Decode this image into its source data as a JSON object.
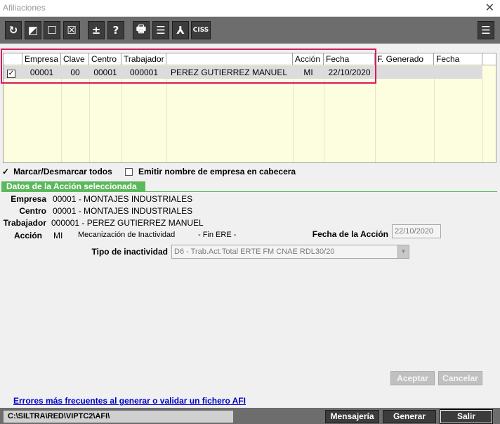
{
  "window": {
    "title": "Afiliaciones",
    "close_glyph": "✕"
  },
  "toolbar": {
    "buttons": [
      {
        "name": "refresh-icon",
        "glyph": "↻"
      },
      {
        "name": "half-select-icon",
        "glyph": "◩"
      },
      {
        "name": "square-icon",
        "glyph": "☐"
      },
      {
        "name": "clear-selection-icon",
        "glyph": "☒"
      },
      {
        "name": "plus-minus-icon",
        "glyph": "±"
      },
      {
        "name": "help-icon",
        "glyph": "?"
      },
      {
        "name": "printer-icon",
        "glyph": "🖶"
      },
      {
        "name": "list-icon",
        "glyph": "☰"
      },
      {
        "name": "pdf-icon",
        "glyph": "⅄"
      },
      {
        "name": "ciss-icon",
        "glyph": "CISS"
      }
    ],
    "menu_glyph": "☰"
  },
  "grid": {
    "headers": [
      "Empresa",
      "Clave",
      "Centro",
      "Trabajador",
      "",
      "Acción",
      "Fecha",
      "F. Generado",
      "Fecha"
    ],
    "rows": [
      {
        "checked": "✓",
        "empresa": "00001",
        "clave": "00",
        "centro": "00001",
        "trabajador": "000001",
        "nombre": "PEREZ GUTIERREZ MANUEL",
        "accion": "MI",
        "fecha": "22/10/2020"
      }
    ]
  },
  "options": {
    "toggle_all_mark": "✓",
    "toggle_all_label": "Marcar/Desmarcar todos",
    "emit_name_label": "Emitir nombre de empresa en cabecera"
  },
  "detail": {
    "section_title": "Datos de la Acción seleccionada",
    "empresa_label": "Empresa",
    "empresa_value": "00001  -  MONTAJES INDUSTRIALES",
    "centro_label": "Centro",
    "centro_value": "00001  -  MONTAJES INDUSTRIALES",
    "trabajador_label": "Trabajador",
    "trabajador_value": "000001  -  PEREZ GUTIERREZ MANUEL",
    "accion_label": "Acción",
    "accion_code": "MI",
    "accion_desc": "Mecanización de Inactividad",
    "accion_extra": "- Fin ERE -",
    "fecha_label": "Fecha de la Acción",
    "fecha_value": "22/10/2020",
    "tipo_label": "Tipo de inactividad",
    "tipo_value": "D6 - Trab.Act.Total ERTE FM CNAE RDL30/20",
    "select_arrow": "▼"
  },
  "dialog_buttons": {
    "accept": "Aceptar",
    "cancel": "Cancelar"
  },
  "footer": {
    "link": "Errores más frecuentes al generar o validar un fichero AFI",
    "path": "C:\\SILTRA\\RED\\VIPTC2\\AFI\\",
    "buttons": {
      "messages": "Mensajería",
      "generate": "Generar",
      "exit": "Salir"
    }
  }
}
